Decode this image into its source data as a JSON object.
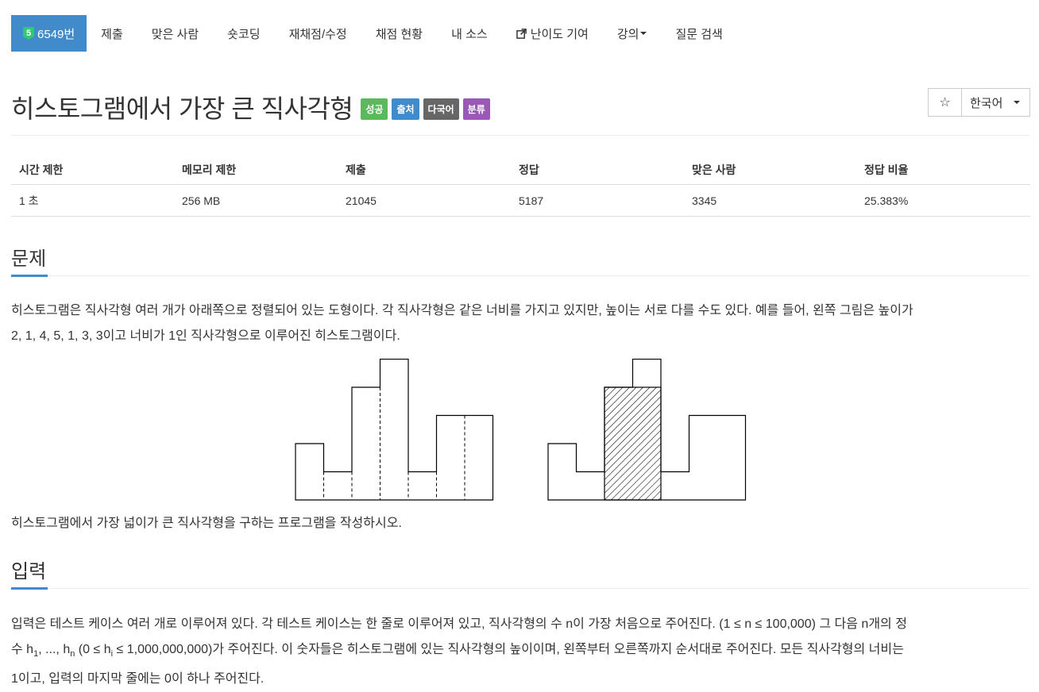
{
  "nav": {
    "brand_icon_text": "5",
    "brand_label": "6549번",
    "items": [
      "제출",
      "맞은 사람",
      "숏코딩",
      "재채점/수정",
      "채점 현황",
      "내 소스"
    ],
    "contrib_label": "난이도 기여",
    "lecture_label": "강의",
    "search_label": "질문 검색"
  },
  "problem": {
    "title": "히스토그램에서 가장 큰 직사각형",
    "labels": [
      "성공",
      "출처",
      "다국어",
      "분류"
    ],
    "star_glyph": "☆",
    "language": "한국어"
  },
  "info_table": {
    "headers": [
      "시간 제한",
      "메모리 제한",
      "제출",
      "정답",
      "맞은 사람",
      "정답 비율"
    ],
    "values": [
      "1 초",
      "256 MB",
      "21045",
      "5187",
      "3345",
      "25.383%"
    ]
  },
  "sections": {
    "problem_heading": "문제",
    "problem_text_1a": "히스토그램은 직사각형 여러 개가 아래쪽으로 정렬되어 있는 도형이다. 각 직사각형은 같은 너비를 가지고 있지만, 높이는 서로 다를 수도 있다. 예를 들어, 왼쪽 그림은 높이가",
    "problem_text_1b": "2, 1, 4, 5, 1, 3, 3이고 너비가 1인 직사각형으로 이루어진 히스토그램이다.",
    "problem_text_2": "히스토그램에서 가장 넓이가 큰 직사각형을 구하는 프로그램을 작성하시오.",
    "input_heading": "입력",
    "input_line1": "입력은 테스트 케이스 여러 개로 이루어져 있다. 각 테스트 케이스는 한 줄로 이루어져 있고, 직사각형의 수 n이 가장 처음으로 주어진다. (1 ≤ n ≤ 100,000) 그 다음 n개의 정",
    "input_line2_a": "수 h",
    "input_line2_sub1": "1",
    "input_line2_b": ", ..., h",
    "input_line2_subn": "n",
    "input_line2_c": " (0 ≤ h",
    "input_line2_subi": "i",
    "input_line2_d": " ≤ 1,000,000,000)가 주어진다. 이 숫자들은 히스토그램에 있는 직사각형의 높이이며, 왼쪽부터 오른쪽까지 순서대로 주어진다. 모든 직사각형의 너비는",
    "input_line3": "1이고, 입력의 마지막 줄에는 0이 하나 주어진다."
  },
  "histogram": {
    "heights": [
      2,
      1,
      4,
      5,
      1,
      3,
      3
    ],
    "max_rect": {
      "start": 2,
      "end": 3,
      "height": 4
    }
  },
  "colors": {
    "brand": "#428bca",
    "success": "#5cb85c",
    "info": "#428bca",
    "default": "#666666",
    "purple": "#9b59b6"
  }
}
